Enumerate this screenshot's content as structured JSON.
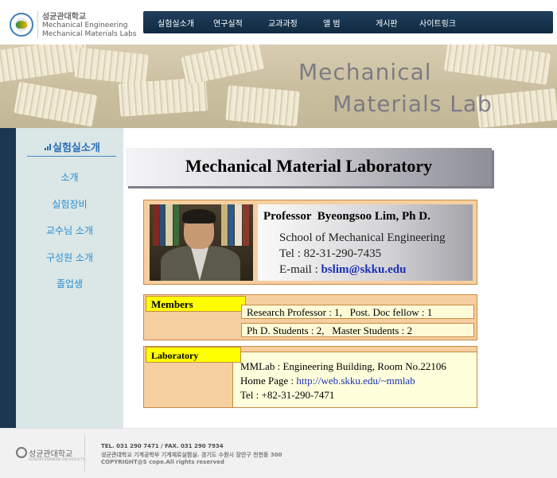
{
  "header": {
    "university": "성균관대학교",
    "lab_line1": "Mechanical Engineering",
    "lab_line2": "Mechanical Materials Labs",
    "nav": [
      "실험실소개",
      "연구실적",
      "교과과정",
      "앨 범",
      "게시판",
      "사이트링크"
    ]
  },
  "banner": {
    "line1": "Mechanical",
    "line2": "Materials Lab"
  },
  "sidebar": {
    "title": "실험실소개",
    "items": [
      "소개",
      "실험장비",
      "교수님 소개",
      "구성원 소개",
      "졸업생"
    ]
  },
  "main": {
    "title": "Mechanical Material Laboratory",
    "professor": {
      "name": "Professor  Byeongsoo Lim, Ph D.",
      "school": "School of Mechanical Engineering",
      "tel": "Tel : 82-31-290-7435",
      "email_label": "E-mail : ",
      "email": "bslim@skku.edu"
    },
    "members": {
      "label": "Members",
      "line1": "Research Professor : 1,   Post. Doc fellow : 1",
      "line2": "Ph D. Students : 2,   Master Students : 2"
    },
    "laboratory": {
      "label": "Laboratory",
      "location": "MMLab : Engineering Building, Room No.22106",
      "homepage_label": "Home Page : ",
      "homepage_url": "http://web.skku.edu/~mmlab",
      "tel": "Tel : +82-31-290-7471"
    }
  },
  "footer": {
    "university": "성균관대학교",
    "university_en": "SUNGKYUNKWAN UNIVERSITY",
    "tel": "TEL. 031 290 7471 / FAX. 031 290 7934",
    "address": "성균관대학교 기계공학부 기계재료실험실. 경기도 수원시 장안구 천천동 300",
    "copyright": "COPYRIGHT@S cope.All rights reserved"
  }
}
